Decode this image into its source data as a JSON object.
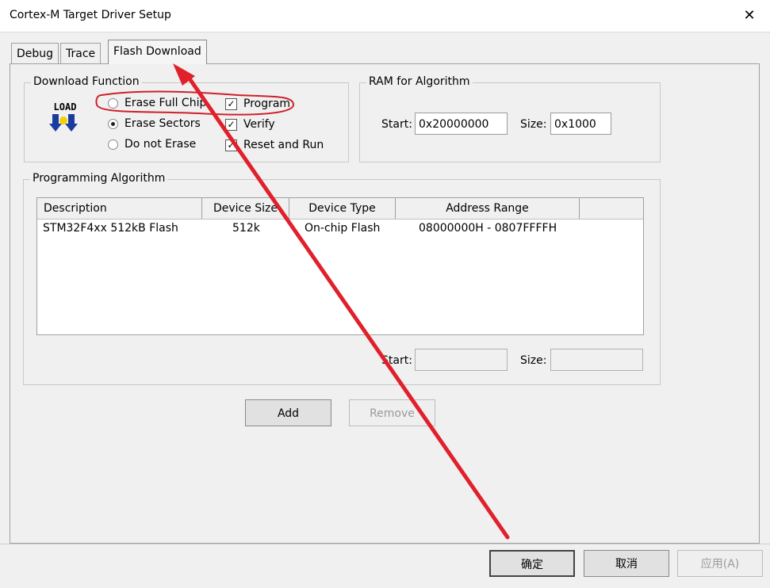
{
  "window": {
    "title": "Cortex-M Target Driver Setup"
  },
  "tabs": [
    {
      "label": "Debug"
    },
    {
      "label": "Trace"
    },
    {
      "label": "Flash Download"
    }
  ],
  "download_function": {
    "title": "Download Function",
    "icon_text": "LOAD",
    "erase_options": [
      {
        "label": "Erase Full Chip",
        "selected": false
      },
      {
        "label": "Erase Sectors",
        "selected": true
      },
      {
        "label": "Do not Erase",
        "selected": false
      }
    ],
    "checks": [
      {
        "label": "Program",
        "checked": true
      },
      {
        "label": "Verify",
        "checked": true
      },
      {
        "label": "Reset and Run",
        "checked": true
      }
    ]
  },
  "ram": {
    "title": "RAM for Algorithm",
    "start_label": "Start:",
    "start_value": "0x20000000",
    "size_label": "Size:",
    "size_value": "0x1000"
  },
  "algorithm": {
    "title": "Programming Algorithm",
    "columns": [
      "Description",
      "Device Size",
      "Device Type",
      "Address Range"
    ],
    "rows": [
      {
        "description": "STM32F4xx 512kB Flash",
        "size": "512k",
        "type": "On-chip Flash",
        "range": "08000000H - 0807FFFFH"
      }
    ],
    "start_label": "Start:",
    "start_value": "",
    "size_label": "Size:",
    "size_value": ""
  },
  "buttons": {
    "add": "Add",
    "remove": "Remove",
    "ok": "确定",
    "cancel": "取消",
    "apply": "应用(A)"
  },
  "annotation_colors": {
    "arrow": "#e0202a",
    "highlight": "#d0202a"
  }
}
